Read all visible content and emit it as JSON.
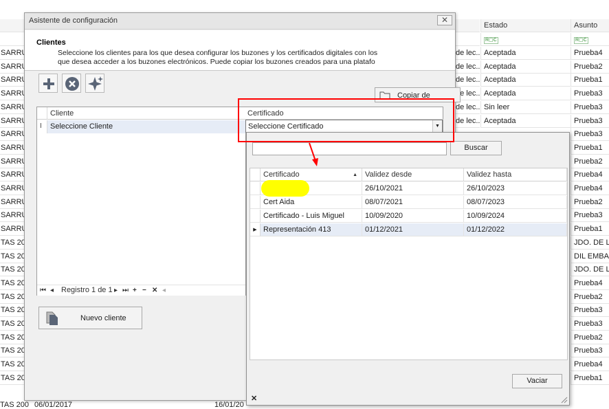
{
  "background": {
    "headers": {
      "estado": "Estado",
      "asunto": "Asunto",
      "filter_icon": "R▢C"
    },
    "left_rows": [
      "SARRU",
      "SARRU",
      "SARRU",
      "SARRU",
      "SARRU",
      "SARRU",
      "SARRU",
      "SARRU",
      "SARRU",
      "SARRU",
      "SARRU",
      "SARRU",
      "SARRU",
      "SARRU",
      "TAS 200",
      "TAS 200",
      "TAS 200",
      "TAS 200",
      "TAS 200",
      "TAS 200",
      "TAS 200",
      "TAS 200",
      "TAS 200",
      "TAS 200",
      "TAS 200"
    ],
    "mid_rows": [
      "de lec...",
      "de lec...",
      "de lec...",
      "de lec...",
      "de lec...",
      "de lec..."
    ],
    "estado_rows": [
      "Aceptada",
      "Aceptada",
      "Aceptada",
      "Aceptada",
      "Sin leer",
      "Aceptada"
    ],
    "asunto_rows": [
      "Prueba4",
      "Prueba2",
      "Prueba1",
      "Prueba3",
      "Prueba3",
      "Prueba3",
      "Prueba3",
      "Prueba1",
      "Prueba2",
      "Prueba4",
      "Prueba4",
      "Prueba2",
      "Prueba3",
      "Prueba1",
      "JDO. DE LO",
      "DIL EMBAR",
      "JDO. DE LO",
      "Prueba4",
      "Prueba2",
      "Prueba3",
      "Prueba3",
      "Prueba2",
      "Prueba3",
      "Prueba4",
      "Prueba1"
    ],
    "bottom_left": "TAS 200",
    "bottom_date1": "06/01/2017",
    "bottom_date2": "16/01/20"
  },
  "dialog": {
    "title": "Asistente de configuración",
    "close_glyph": "✕",
    "section_title": "Clientes",
    "description": "Seleccione los clientes para los que desea configurar los buzones y los certificados digitales con los que desea acceder a los buzones electrónicos. Puede copiar los buzones creados para una platafo",
    "copy_button": "Copiar de",
    "grid": {
      "col_cliente": "Cliente",
      "col_certificado": "Certificado",
      "row_cliente": "Seleccione Cliente",
      "row_certificado": "Seleccione Certificado",
      "nav_record": "Registro 1 de 1"
    },
    "new_client_button": "Nuevo cliente"
  },
  "popup": {
    "search_value": "",
    "search_button": "Buscar",
    "columns": [
      "Certificado",
      "Validez desde",
      "Validez hasta"
    ],
    "rows": [
      {
        "certificado": "",
        "desde": "26/10/2021",
        "hasta": "26/10/2023",
        "selected": false
      },
      {
        "certificado": "Cert Aida",
        "desde": "08/07/2021",
        "hasta": "08/07/2023",
        "selected": false
      },
      {
        "certificado": "Certificado - Luis Miguel",
        "desde": "10/09/2020",
        "hasta": "10/09/2024",
        "selected": false
      },
      {
        "certificado": "Representación 413",
        "desde": "01/12/2021",
        "hasta": "01/12/2022",
        "selected": true
      }
    ],
    "clear_button": "Vaciar",
    "close_glyph": "✕"
  },
  "colors": {
    "annotation_red": "#ff0000",
    "highlight_yellow": "#ffff00",
    "selection": "#e6ecf6"
  }
}
